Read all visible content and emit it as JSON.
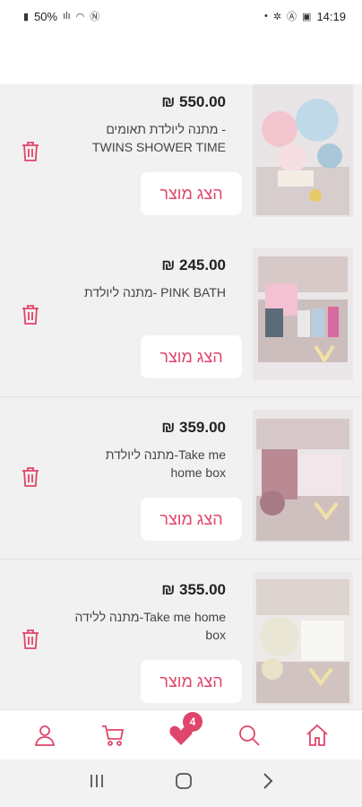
{
  "status_bar": {
    "battery": "50%",
    "time": "14:19"
  },
  "items": [
    {
      "price": "₪ 550.00",
      "title": "מתנה ליולדת תאומים - TWINS SHOWER TIME",
      "button": "הצג מוצר"
    },
    {
      "price": "₪ 245.00",
      "title": "מתנה ליולדת- PINK BATH",
      "button": "הצג מוצר"
    },
    {
      "price": "₪ 359.00",
      "title": "מתנה ליולדת-Take me home box",
      "button": "הצג מוצר"
    },
    {
      "price": "₪ 355.00",
      "title": "מתנה ללידה-Take me home box",
      "button": "הצג מוצר"
    }
  ],
  "bottom_nav": {
    "wishlist_badge": "4",
    "items": [
      "user-icon",
      "cart-icon",
      "heart-icon",
      "search-icon",
      "home-icon"
    ]
  },
  "colors": {
    "accent": "#e0456b",
    "list_bg": "#f1f1f1"
  }
}
